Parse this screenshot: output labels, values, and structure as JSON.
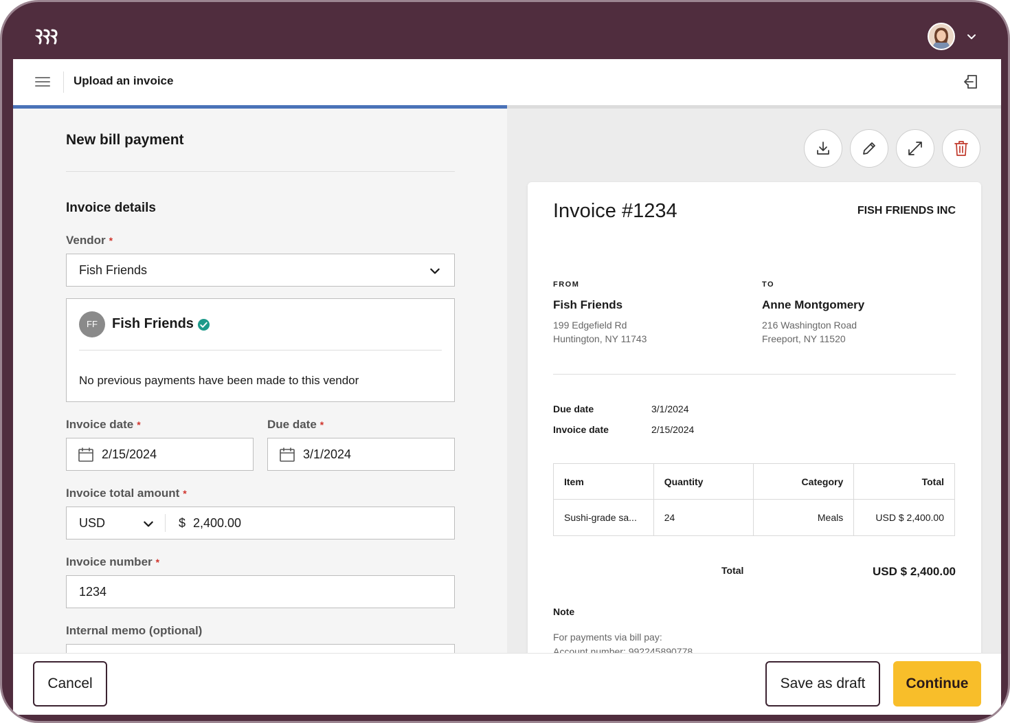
{
  "colors": {
    "frame": "#502d3e",
    "progress": "#4a72b8",
    "primary_button": "#f8be2a",
    "required_marker": "#d0342c",
    "verified": "#1e9a8a",
    "delete_icon": "#c0392b"
  },
  "icons": {
    "logo": "brand-logo",
    "avatar_chevron": "chevron-down-icon",
    "menu": "hamburger-menu-icon",
    "exit": "exit-icon",
    "vendor_select": "chevron-down-icon",
    "verified": "check-circle-icon",
    "calendar": "calendar-icon",
    "currency_select": "chevron-down-icon",
    "download": "download-icon",
    "edit": "pencil-icon",
    "expand": "expand-icon",
    "delete": "trash-icon"
  },
  "header": {
    "title": "Upload an invoice"
  },
  "progress": {
    "fraction": 0.5
  },
  "form": {
    "page_heading": "New bill payment",
    "section_heading": "Invoice details",
    "required_marker": "*",
    "vendor": {
      "label": "Vendor",
      "value": "Fish Friends"
    },
    "vendor_card": {
      "initials": "FF",
      "name": "Fish Friends",
      "message": "No previous payments have been made to this vendor"
    },
    "invoice_date": {
      "label": "Invoice date",
      "value": "2/15/2024"
    },
    "due_date": {
      "label": "Due date",
      "value": "3/1/2024"
    },
    "amount": {
      "label": "Invoice total amount",
      "currency": "USD",
      "symbol": "$",
      "value": "2,400.00"
    },
    "invoice_number": {
      "label": "Invoice number",
      "value": "1234"
    },
    "memo": {
      "label": "Internal memo (optional)",
      "value": ""
    }
  },
  "invoice": {
    "title": "Invoice #1234",
    "company": "FISH FRIENDS INC",
    "from": {
      "caption": "FROM",
      "name": "Fish Friends",
      "address_line1": "199 Edgefield Rd",
      "address_line2": "Huntington, NY 11743"
    },
    "to": {
      "caption": "TO",
      "name": "Anne Montgomery",
      "address_line1": "216 Washington Road",
      "address_line2": "Freeport, NY 11520"
    },
    "due_date_label": "Due date",
    "due_date_value": "3/1/2024",
    "invoice_date_label": "Invoice date",
    "invoice_date_value": "2/15/2024",
    "table": {
      "headers": [
        "Item",
        "Quantity",
        "Category",
        "Total"
      ],
      "rows": [
        [
          "Sushi-grade sa...",
          "24",
          "Meals",
          "USD $ 2,400.00"
        ]
      ]
    },
    "total_label": "Total",
    "total_value": "USD $ 2,400.00",
    "note_label": "Note",
    "note_line1": "For payments via bill pay:",
    "note_line2": "Account number: 992245890778"
  },
  "footer": {
    "cancel": "Cancel",
    "save_draft": "Save as draft",
    "continue": "Continue"
  }
}
